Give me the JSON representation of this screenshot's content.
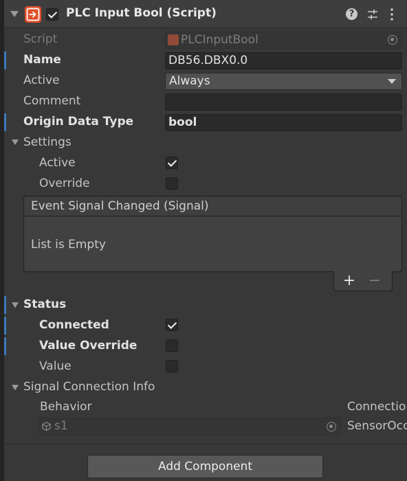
{
  "header": {
    "title": "PLC Input Bool (Script)",
    "enabled": true
  },
  "fields": {
    "script_label": "Script",
    "script_value": "PLCInputBool",
    "name_label": "Name",
    "name_value": "DB56.DBX0.0",
    "active_label": "Active",
    "active_value": "Always",
    "comment_label": "Comment",
    "comment_value": "",
    "origin_label": "Origin Data Type",
    "origin_value": "bool"
  },
  "settings": {
    "label": "Settings",
    "active_label": "Active",
    "active_checked": true,
    "override_label": "Override",
    "override_checked": false,
    "event_header": "Event Signal Changed (Signal)",
    "event_empty": "List is Empty",
    "add_glyph": "+",
    "remove_glyph": "−"
  },
  "status": {
    "label": "Status",
    "connected_label": "Connected",
    "connected_checked": true,
    "value_override_label": "Value Override",
    "value_override_checked": false,
    "value_label": "Value",
    "value_checked": false
  },
  "signal_info": {
    "label": "Signal Connection Info",
    "col_behavior": "Behavior",
    "col_connection": "Connectio",
    "row_behavior_value": "s1",
    "row_connection_value": "SensorOcc"
  },
  "footer": {
    "add_component": "Add Component"
  },
  "colors": {
    "accent_marker": "#3a79bb",
    "script_icon": "#e0502a"
  },
  "icons": [
    "foldout-icon",
    "script-icon",
    "help-icon",
    "preset-icon",
    "more-icon",
    "object-picker-icon",
    "gameobject-icon"
  ]
}
